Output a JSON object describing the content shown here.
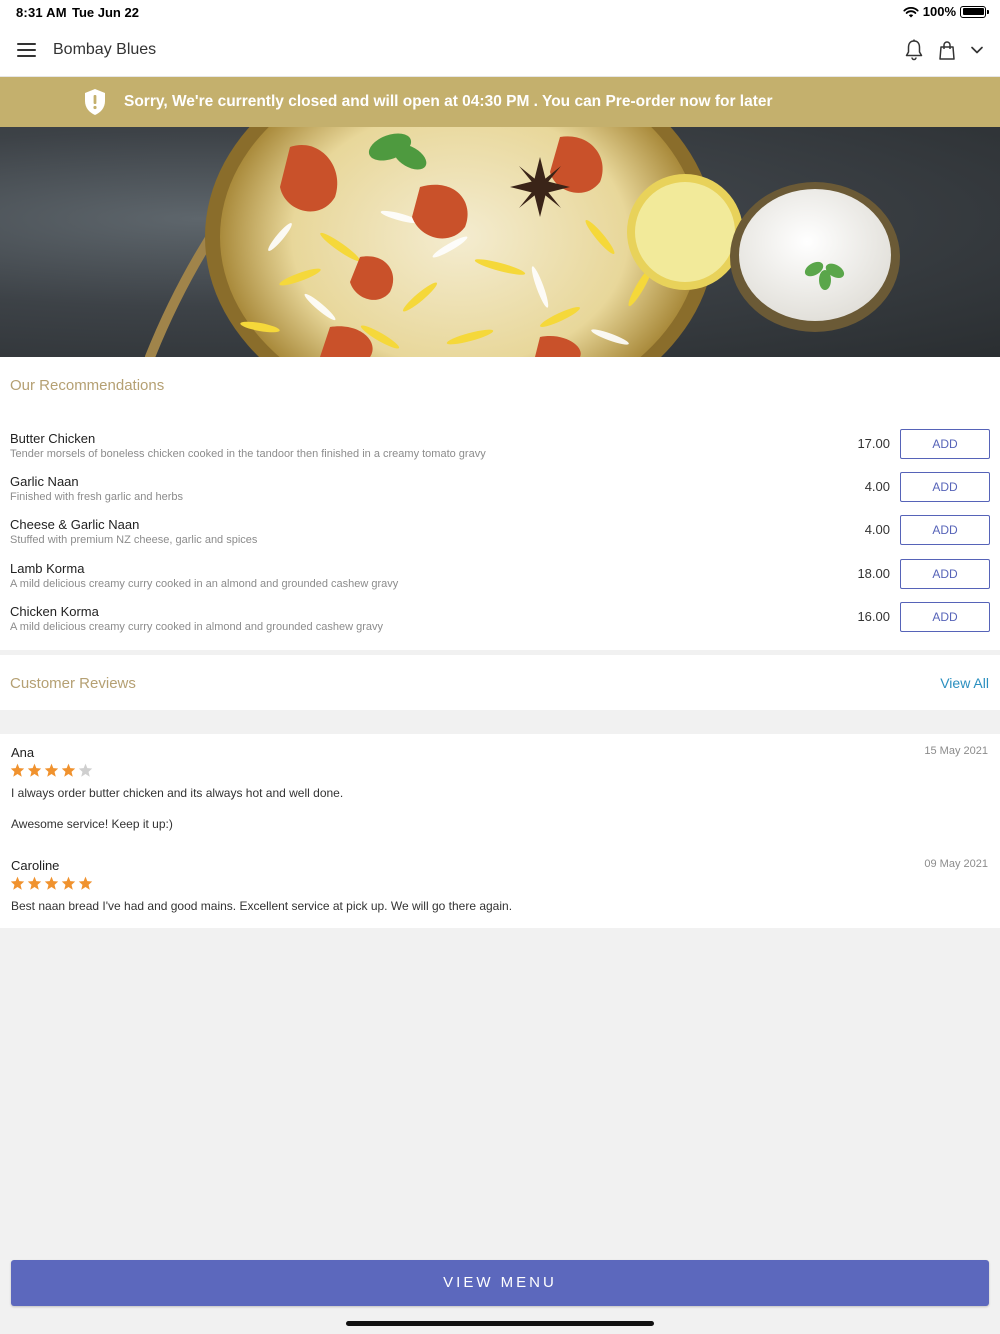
{
  "status_bar": {
    "time": "8:31 AM",
    "date": "Tue Jun 22",
    "battery": "100%"
  },
  "header": {
    "title": "Bombay Blues",
    "icons": [
      "menu-icon",
      "bell-icon",
      "bag-icon",
      "chevron-down-icon"
    ]
  },
  "banner": {
    "message": "Sorry, We're currently closed and will open at 04:30 PM . You can Pre-order now for later",
    "color": "#c4b06d"
  },
  "recommendations": {
    "title": "Our Recommendations",
    "items": [
      {
        "name": "Butter Chicken",
        "description": "Tender morsels of boneless chicken cooked in the tandoor then finished in a creamy tomato gravy",
        "price": "17.00",
        "button": "ADD"
      },
      {
        "name": "Garlic Naan",
        "description": "Finished with fresh garlic and herbs",
        "price": "4.00",
        "button": "ADD"
      },
      {
        "name": "Cheese & Garlic Naan",
        "description": "Stuffed with premium NZ cheese, garlic and spices",
        "price": "4.00",
        "button": "ADD"
      },
      {
        "name": "Lamb Korma",
        "description": "A mild delicious creamy curry cooked in an almond and grounded cashew gravy",
        "price": "18.00",
        "button": "ADD"
      },
      {
        "name": "Chicken Korma",
        "description": "A mild delicious creamy curry cooked in almond and grounded cashew gravy",
        "price": "16.00",
        "button": "ADD"
      }
    ]
  },
  "reviews": {
    "title": "Customer Reviews",
    "view_all": "View All",
    "items": [
      {
        "author": "Ana",
        "date": "15 May 2021",
        "rating": 4,
        "lines": [
          "I always order butter chicken and its always hot and well done.",
          "Awesome service! Keep it up:)"
        ]
      },
      {
        "author": "Caroline",
        "date": "09 May 2021",
        "rating": 5,
        "lines": [
          "Best naan bread I've had and good mains. Excellent service at pick up. We will go there again."
        ]
      }
    ]
  },
  "footer": {
    "button": "VIEW MENU",
    "accent": "#5c68bd"
  },
  "colors": {
    "star_filled": "#f0922e",
    "star_empty": "#cfcfcf",
    "section_title": "#b5a073",
    "link": "#2a8fbf"
  }
}
